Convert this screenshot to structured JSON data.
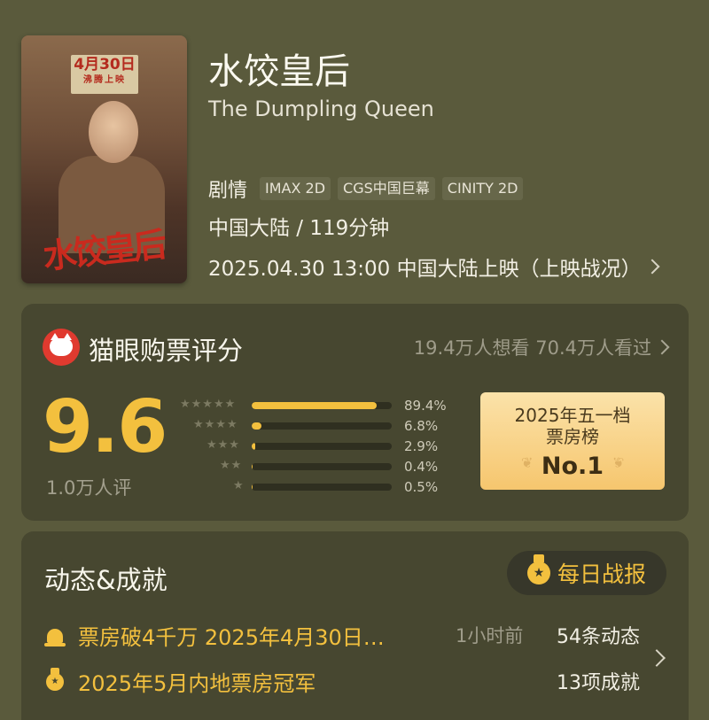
{
  "movie": {
    "title_cn": "水饺皇后",
    "title_en": "The Dumpling Queen",
    "genre": "剧情",
    "tags": [
      "IMAX 2D",
      "CGS中国巨幕",
      "CINITY 2D"
    ],
    "region_duration": "中国大陆 / 119分钟",
    "release": "2025.04.30 13:00 中国大陆上映（上映战况）",
    "poster": {
      "date": "4月30日",
      "date_sub": "沸腾上映",
      "title_art": "水饺皇后"
    }
  },
  "rating": {
    "title": "猫眼购票评分",
    "stats": "19.4万人想看 70.4万人看过",
    "score": "9.6",
    "count": "1.0万人评",
    "distribution": [
      {
        "stars": "★★★★★",
        "pct_label": "89.4%",
        "pct": 89.4
      },
      {
        "stars": "★★★★",
        "pct_label": "6.8%",
        "pct": 6.8
      },
      {
        "stars": "★★★",
        "pct_label": "2.9%",
        "pct": 2.9
      },
      {
        "stars": "★★",
        "pct_label": "0.4%",
        "pct": 0.4
      },
      {
        "stars": "★",
        "pct_label": "0.5%",
        "pct": 0.5
      }
    ],
    "rank": {
      "line1": "2025年五一档",
      "line2": "票房榜",
      "no": "No.1"
    }
  },
  "achievements": {
    "title": "动态&成就",
    "daily_button": "每日战报",
    "items": [
      {
        "text": "票房破4千万 2025年4月30日…",
        "icon": "bell-icon"
      },
      {
        "text": "2025年5月内地票房冠军",
        "icon": "medal-icon"
      }
    ],
    "time_ago": "1小时前",
    "updates_count": "54条动态",
    "achievements_count": "13项成就"
  },
  "colors": {
    "background": "#5a5a3c",
    "card": "#474730",
    "accent": "#f3c03e",
    "badge_top": "#fbe2a9",
    "badge_bottom": "#f6c66e"
  }
}
